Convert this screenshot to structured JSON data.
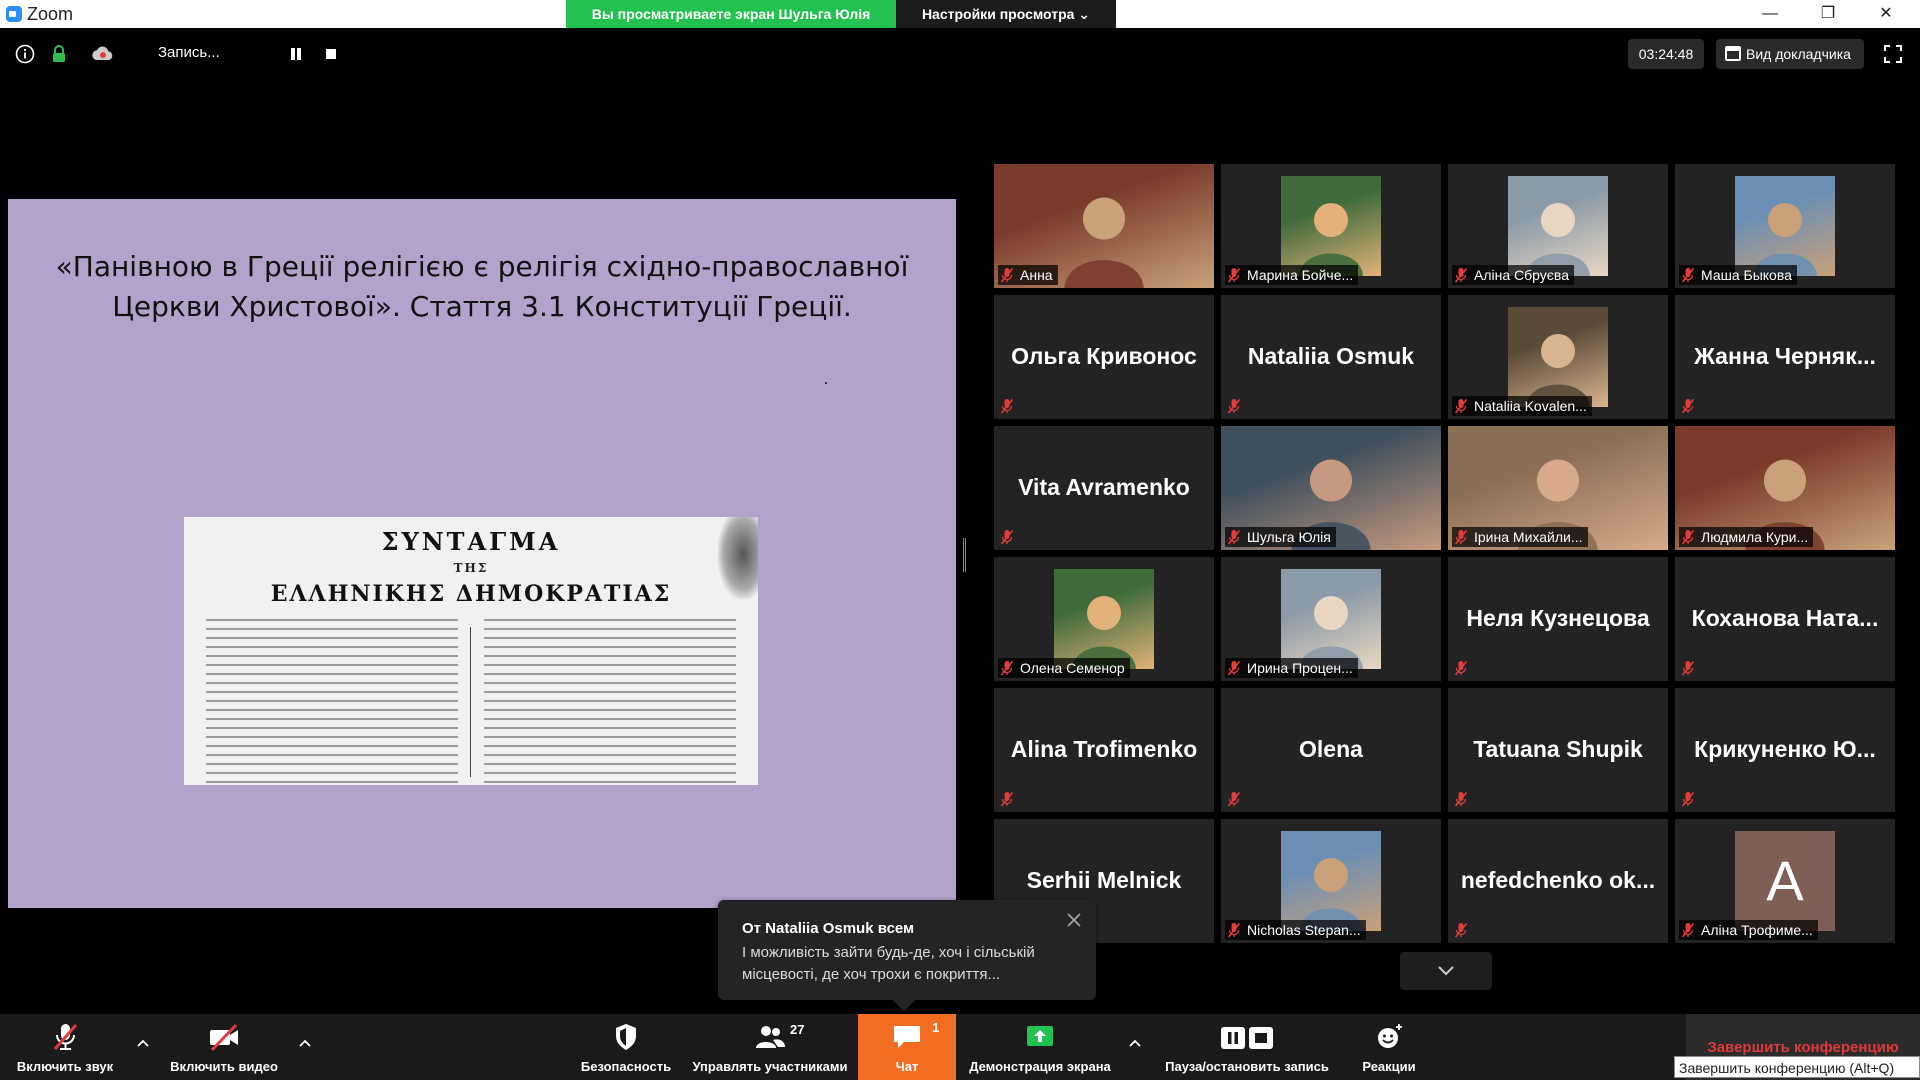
{
  "window": {
    "app_title": "Zoom",
    "share_banner": "Вы просматриваете экран Шульга Юлія",
    "view_settings": "Настройки просмотра ⌄",
    "minimize": "—",
    "maximize": "❐",
    "close": "✕"
  },
  "topbar": {
    "recording_label": "Запись...",
    "timer": "03:24:48",
    "speaker_view": "Вид докладчика"
  },
  "slide": {
    "title": "«Панівною в Греції релігією є релігія східно-православної Церкви Христової». Стаття 3.1 Конституції Греції.",
    "doc_heading_1": "ΣΥΝΤΑΓΜΑ",
    "doc_heading_2": "ΤΗΣ",
    "doc_heading_3": "ΕΛΛΗΝΙΚΗΣ ΔΗΜΟΚΡΑΤΙΑΣ"
  },
  "participants": [
    {
      "name": "Анна",
      "type": "video"
    },
    {
      "name": "Марина Бойче...",
      "type": "photo"
    },
    {
      "name": "Аліна Сбруєва",
      "type": "photo"
    },
    {
      "name": "Маша Быкова",
      "type": "photo"
    },
    {
      "name": "Ольга Кривонос",
      "type": "name"
    },
    {
      "name": "Nataliia Osmuk",
      "type": "name"
    },
    {
      "name": "Nataliia Kovalen...",
      "type": "photo"
    },
    {
      "name": "Жанна Черняк...",
      "type": "name"
    },
    {
      "name": "Vita Avramenko",
      "type": "name"
    },
    {
      "name": "Шульга Юлія",
      "type": "video",
      "active": true
    },
    {
      "name": "Ірина Михайли...",
      "type": "video"
    },
    {
      "name": "Людмила Кури...",
      "type": "video"
    },
    {
      "name": "Олена Семенор",
      "type": "photo"
    },
    {
      "name": "Ирина Процен...",
      "type": "photo"
    },
    {
      "name": "Неля Кузнецова",
      "type": "name"
    },
    {
      "name": "Коханова Ната...",
      "type": "name"
    },
    {
      "name": "Alina Trofimenko",
      "type": "name"
    },
    {
      "name": "Olena",
      "type": "name"
    },
    {
      "name": "Tatuana Shupik",
      "type": "name"
    },
    {
      "name": "Крикуненко Ю...",
      "type": "name"
    },
    {
      "name": "Serhii Melnick",
      "type": "name"
    },
    {
      "name": "Nicholas Stepan...",
      "type": "photo"
    },
    {
      "name": "nefedchenko ok...",
      "type": "name"
    },
    {
      "name": "Аліна Трофиме...",
      "type": "letter",
      "letter": "A"
    }
  ],
  "chat_popup": {
    "from": "От Nataliia Osmuk всем",
    "message": "І можливість зайти будь-де, хоч і сільській місцевості, де хоч трохи є покриття..."
  },
  "toolbar": {
    "unmute": "Включить звук",
    "start_video": "Включить видео",
    "security": "Безопасность",
    "participants": "Управлять участниками",
    "participants_count": "27",
    "chat": "Чат",
    "chat_badge": "1",
    "share_screen": "Демонстрация экрана",
    "pause_recording": "Пауза/остановить запись",
    "reactions": "Реакции",
    "end_meeting": "Завершить конференцию",
    "end_tooltip": "Завершить конференцию (Alt+Q)"
  }
}
